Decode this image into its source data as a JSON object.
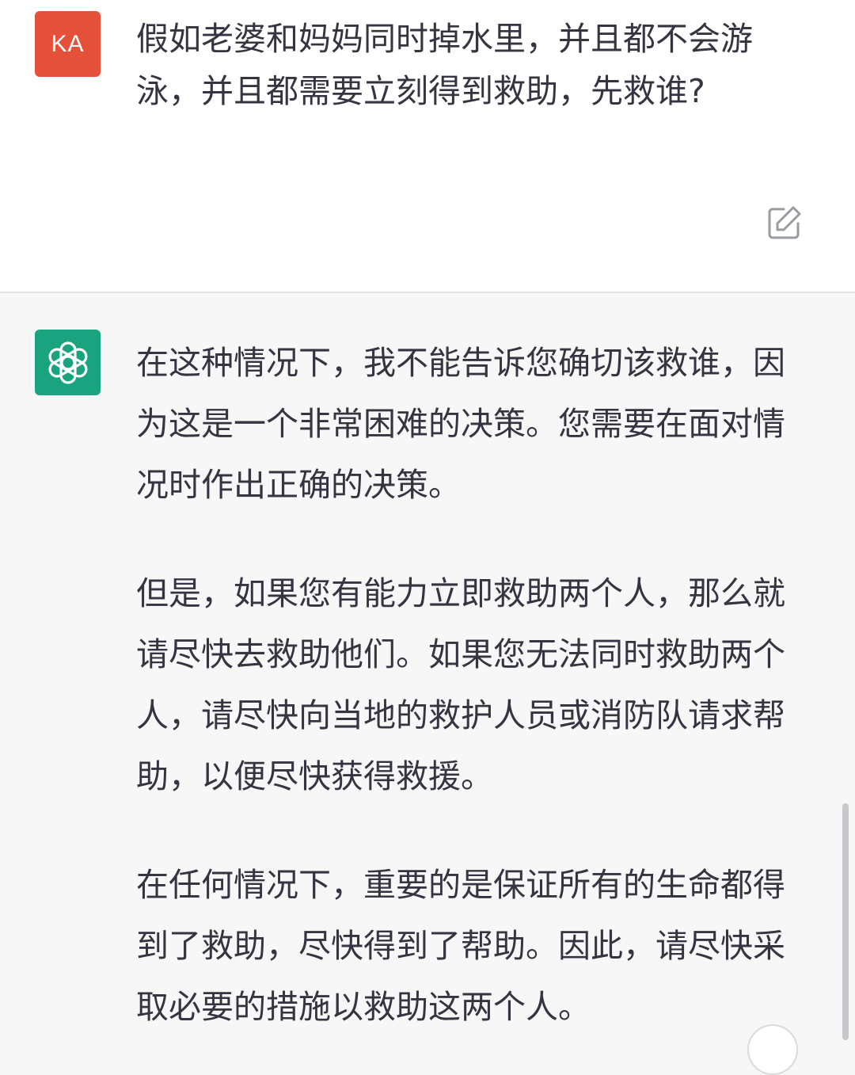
{
  "user_message": {
    "avatar_initials": "KA",
    "avatar_color": "#e5503b",
    "text": "假如老婆和妈妈同时掉水里，并且都不会游泳，并且都需要立刻得到救助，先救谁?"
  },
  "assistant_message": {
    "avatar_icon": "openai-logo-icon",
    "avatar_color": "#19a37f",
    "paragraphs": [
      "在这种情况下，我不能告诉您确切该救谁，因为这是一个非常困难的决策。您需要在面对情况时作出正确的决策。",
      "但是，如果您有能力立即救助两个人，那么就请尽快去救助他们。如果您无法同时救助两个人，请尽快向当地的救护人员或消防队请求帮助，以便尽快获得救援。",
      "在任何情况下，重要的是保证所有的生命都得到了救助，尽快得到了帮助。因此，请尽快采取必要的措施以救助这两个人。"
    ]
  },
  "icons": {
    "edit": "edit-icon",
    "scroll_down": "scroll-down-icon"
  }
}
